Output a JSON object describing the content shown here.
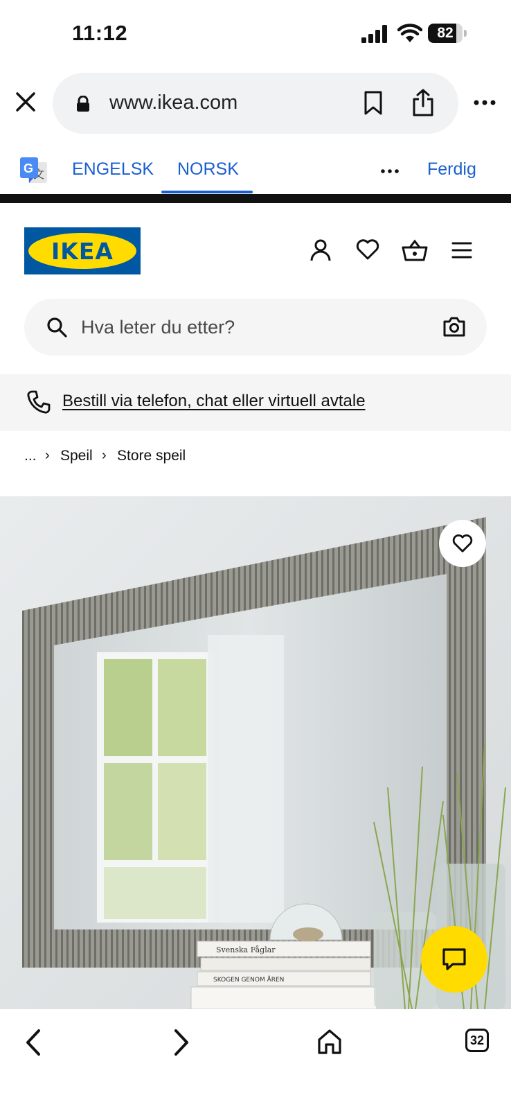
{
  "status_bar": {
    "time": "11:12",
    "battery_level": "82",
    "icons": [
      "cellular-signal-icon",
      "wifi-icon",
      "battery-icon"
    ]
  },
  "browser": {
    "url": "www.ikea.com",
    "icons": [
      "close-icon",
      "lock-icon",
      "bookmark-icon",
      "share-icon",
      "more-icon"
    ]
  },
  "translate_bar": {
    "source_language": "ENGELSK",
    "target_language": "NORSK",
    "active_tab": "NORSK",
    "done_label": "Ferdig",
    "icons": [
      "google-translate-icon",
      "more-dots-icon"
    ]
  },
  "header": {
    "logo_text": "IKEA",
    "icons": [
      "account-icon",
      "heart-icon",
      "basket-icon",
      "menu-icon"
    ]
  },
  "search": {
    "placeholder": "Hva leter du etter?",
    "icons": [
      "search-icon",
      "camera-icon"
    ]
  },
  "contact_banner": {
    "text": "Bestill via telefon, chat eller virtuell avtale",
    "icon": "phone-icon"
  },
  "breadcrumb": {
    "items": [
      "...",
      "Speil",
      "Store speil"
    ]
  },
  "product_image": {
    "book_titles": [
      "Svenska Fåglar",
      "SKOGEN GENOM ÅREN"
    ],
    "icons": [
      "favorite-heart-icon",
      "chat-icon"
    ]
  },
  "bottom_nav": {
    "tab_count": "32",
    "icons": [
      "back-arrow-icon",
      "forward-arrow-icon",
      "home-icon",
      "tabs-icon"
    ]
  },
  "colors": {
    "ikea_blue": "#0058a3",
    "ikea_yellow": "#ffdb00",
    "link_blue": "#1a5fd0"
  }
}
